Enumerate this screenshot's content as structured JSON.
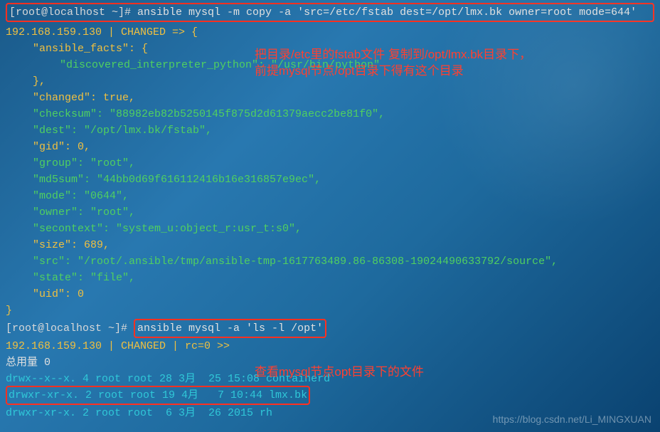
{
  "cmd1": {
    "prompt": "[root@localhost ~]# ",
    "command": "ansible mysql -m copy -a 'src=/etc/fstab dest=/opt/lmx.bk owner=root mode=644'"
  },
  "output1": {
    "host_line": "192.168.159.130 | CHANGED => {",
    "ansible_facts_open": "\"ansible_facts\": {",
    "discovered": "\"discovered_interpreter_python\": \"/usr/bin/python\"",
    "close1": "},",
    "changed": "\"changed\": true,",
    "checksum": "\"checksum\": \"88982eb82b5250145f875d2d61379aecc2be81f0\",",
    "dest": "\"dest\": \"/opt/lmx.bk/fstab\",",
    "gid": "\"gid\": 0,",
    "group": "\"group\": \"root\",",
    "md5sum": "\"md5sum\": \"44bb0d69f616112416b16e316857e9ec\",",
    "mode": "\"mode\": \"0644\",",
    "owner": "\"owner\": \"root\",",
    "secontext": "\"secontext\": \"system_u:object_r:usr_t:s0\",",
    "size": "\"size\": 689,",
    "src": "\"src\": \"/root/.ansible/tmp/ansible-tmp-1617763489.86-86308-19024490633792/source\",",
    "state": "\"state\": \"file\",",
    "uid": "\"uid\": 0",
    "close2": "}"
  },
  "cmd2": {
    "prompt": "[root@localhost ~]# ",
    "command": "ansible mysql -a 'ls -l /opt'"
  },
  "output2": {
    "host_line": "192.168.159.130 | CHANGED | rc=0 >>",
    "total": "总用量 0",
    "row1": "drwx--x--x. 4 root root 28 3月  25 15:08 containerd",
    "row2": "drwxr-xr-x. 2 root root 19 4月   7 10:44 lmx.bk",
    "row3": "drwxr-xr-x. 2 root root  6 3月  26 2015 rh"
  },
  "annotations": {
    "a1": "把目录/etc里的fstab文件 复制到/opt/lmx.bk目录下，",
    "a2": "前提mysql节点/opt目录下得有这个目录",
    "a3": "查看mysql节点opt目录下的文件"
  },
  "watermark": "https://blog.csdn.net/Li_MINGXUAN"
}
